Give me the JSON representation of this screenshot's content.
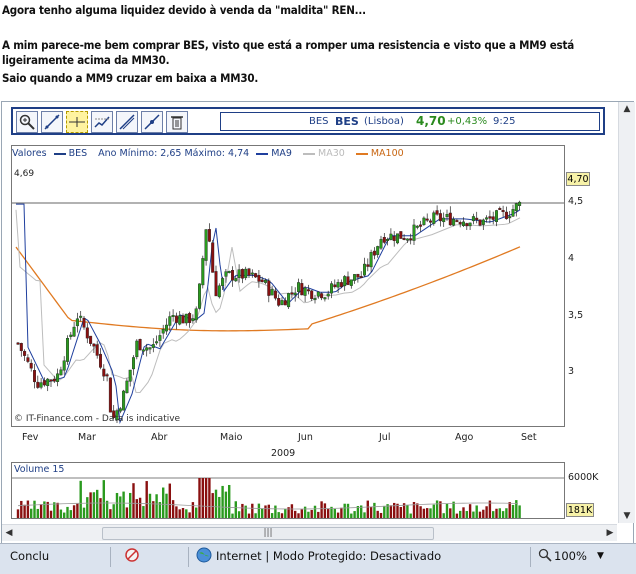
{
  "post": {
    "line1": "Agora tenho alguma liquidez devido à venda da \"maldita\" REN...",
    "line2": "A mim parece-me bem comprar BES, visto que está a romper uma resistencia e visto que a MM9 está ligeiramente acima da MM30.",
    "line3": "Saio quando a MM9 cruzar em baixa a MM30."
  },
  "quote": {
    "ticker_name": "BES",
    "symbol": "BES",
    "exchange": "(Lisboa)",
    "price": "4,70",
    "change": "+0,43%",
    "time": "9:25"
  },
  "legend": {
    "values_label": "Valores",
    "series_bes": "BES",
    "min_max": "Ano Mínimo: 2,65 Máximo: 4,74",
    "ma9": "MA9",
    "ma30": "MA30",
    "ma100": "MA100"
  },
  "colors": {
    "up": "#2a9a1e",
    "down": "#8a1010",
    "ma9": "#1f3f9e",
    "ma30": "#bdbdbd",
    "ma100": "#e07a22",
    "brand": "#1f3f86"
  },
  "chart_data": {
    "type": "candlestick",
    "y_ticks": [
      "4,5",
      "4",
      "3,5",
      "3"
    ],
    "x_ticks": [
      "Fev",
      "Mar",
      "Abr",
      "Maio",
      "Jun",
      "Jul",
      "Ago",
      "Set"
    ],
    "year": "2009",
    "level_line_label": "4,69",
    "last_price_badge": "4,70",
    "watermark": "© IT-Finance.com - Data is indicative",
    "ylim": [
      2.65,
      4.74
    ]
  },
  "volume": {
    "label": "Volume 15",
    "tick": "6000K",
    "badge": "181K"
  },
  "status": {
    "left": "Conclu",
    "zone": "Internet | Modo Protegido: Desactivado",
    "zoom": "100%"
  },
  "icons": [
    "zoom-icon",
    "line-tool-icon",
    "crosshair-icon",
    "indicator-icon",
    "draw-icon",
    "trend-icon",
    "trash-icon",
    "globe-icon",
    "popup-blocked-icon",
    "zoom-status-icon"
  ]
}
